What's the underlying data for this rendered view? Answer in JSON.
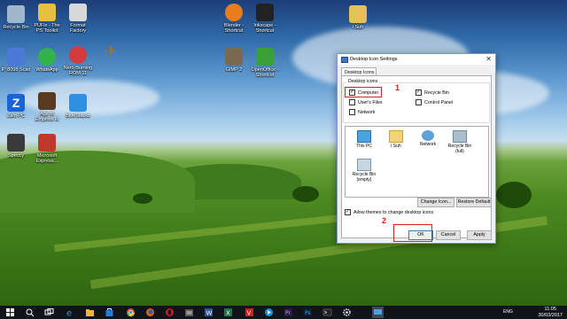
{
  "desktop": {
    "icons": [
      {
        "label": "Recycle Bin",
        "color": "#9fb7c9"
      },
      {
        "label": "PUFix - The PS Toolkit",
        "color": "#e8c040"
      },
      {
        "label": "Format Factory",
        "color": "#d8d8d8"
      },
      {
        "label": "IP 8098 Scan",
        "color": "#4b7bd6"
      },
      {
        "label": "WhatsApp",
        "color": "#2fb34a"
      },
      {
        "label": "Nero Burning ROM 11",
        "color": "#d23b3b"
      },
      {
        "label": "Zalo PC",
        "color": "#1a63d6"
      },
      {
        "label": "Age of Empires III",
        "color": "#5a3b22"
      },
      {
        "label": "BlueStacks",
        "color": "#2f8fe0"
      },
      {
        "label": "Speccy",
        "color": "#3a3a3a"
      },
      {
        "label": "Microsoft Express...",
        "color": "#c0392b"
      },
      {
        "label": "Blender - Shortcut",
        "color": "#e87d1e"
      },
      {
        "label": "Inkscape - Shortcut",
        "color": "#222222"
      },
      {
        "label": "GIMP 2",
        "color": "#7a6a52"
      },
      {
        "label": "OpenOffice - Shortcut",
        "color": "#3aa03a"
      },
      {
        "label": "i Suh",
        "color": "#e6c15a"
      }
    ]
  },
  "dialog": {
    "title": "Desktop Icon Settings",
    "tab": "Desktop Icons",
    "group_label": "Desktop icons",
    "checkboxes": [
      {
        "label": "Computer",
        "checked": true
      },
      {
        "label": "User's Files",
        "checked": false
      },
      {
        "label": "Network",
        "checked": false
      },
      {
        "label": "Recycle Bin",
        "checked": true
      },
      {
        "label": "Control Panel",
        "checked": false
      }
    ],
    "list_items": [
      {
        "label": "This PC"
      },
      {
        "label": "i Suh"
      },
      {
        "label": "Network"
      },
      {
        "label": "Recycle Bin (full)"
      },
      {
        "label": "Recycle Bin (empty)"
      }
    ],
    "change_icon": "Change Icon...",
    "restore_default": "Restore Default",
    "allow_themes": "Allow themes to change desktop icons",
    "ok": "OK",
    "cancel": "Cancel",
    "apply": "Apply"
  },
  "annotations": {
    "one": "1",
    "two": "2",
    "color": "#e02020"
  },
  "taskbar": {
    "lang": "ENG",
    "time": "11:05",
    "date": "30/03/2017"
  }
}
